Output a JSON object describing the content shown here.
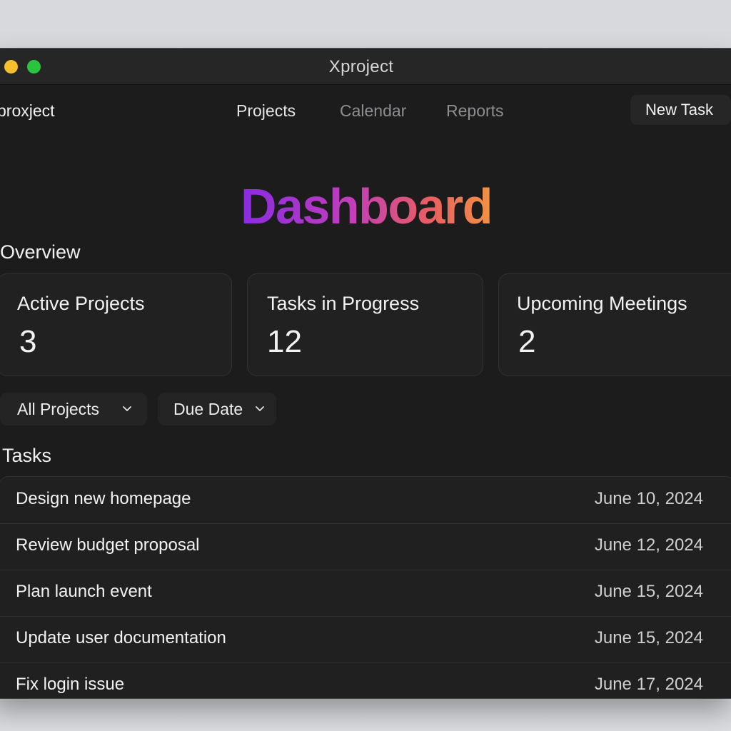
{
  "window": {
    "title": "Xproject"
  },
  "navbar": {
    "brand": "proxject",
    "links": [
      {
        "label": "Projects",
        "active": true
      },
      {
        "label": "Calendar",
        "active": false
      },
      {
        "label": "Reports",
        "active": false
      }
    ],
    "new_task_label": "New Task"
  },
  "hero": {
    "title": "Dashboard",
    "gradient_colors": [
      "#8a2be2",
      "#c23fb9",
      "#ea5d62",
      "#f29342"
    ]
  },
  "overview": {
    "title": "Overview",
    "cards": [
      {
        "label": "Active Projects",
        "value": "3"
      },
      {
        "label": "Tasks in Progress",
        "value": "12"
      },
      {
        "label": "Upcoming Meetings",
        "value": "2"
      }
    ]
  },
  "filters": [
    {
      "label": "All Projects",
      "icon": "chevron-down-icon"
    },
    {
      "label": "Due Date",
      "icon": "chevron-down-icon"
    }
  ],
  "tasks": {
    "title": "Tasks",
    "items": [
      {
        "name": "Design new homepage",
        "due": "June 10, 2024"
      },
      {
        "name": "Review budget proposal",
        "due": "June 12, 2024"
      },
      {
        "name": "Plan launch event",
        "due": "June 15, 2024"
      },
      {
        "name": "Update user documentation",
        "due": "June 15, 2024"
      },
      {
        "name": "Fix login issue",
        "due": "June 17, 2024"
      }
    ]
  },
  "colors": {
    "window_bg": "#1c1c1d",
    "card_bg": "#212122",
    "traffic_yellow": "#f5bf2e",
    "traffic_green": "#2ac43f"
  }
}
